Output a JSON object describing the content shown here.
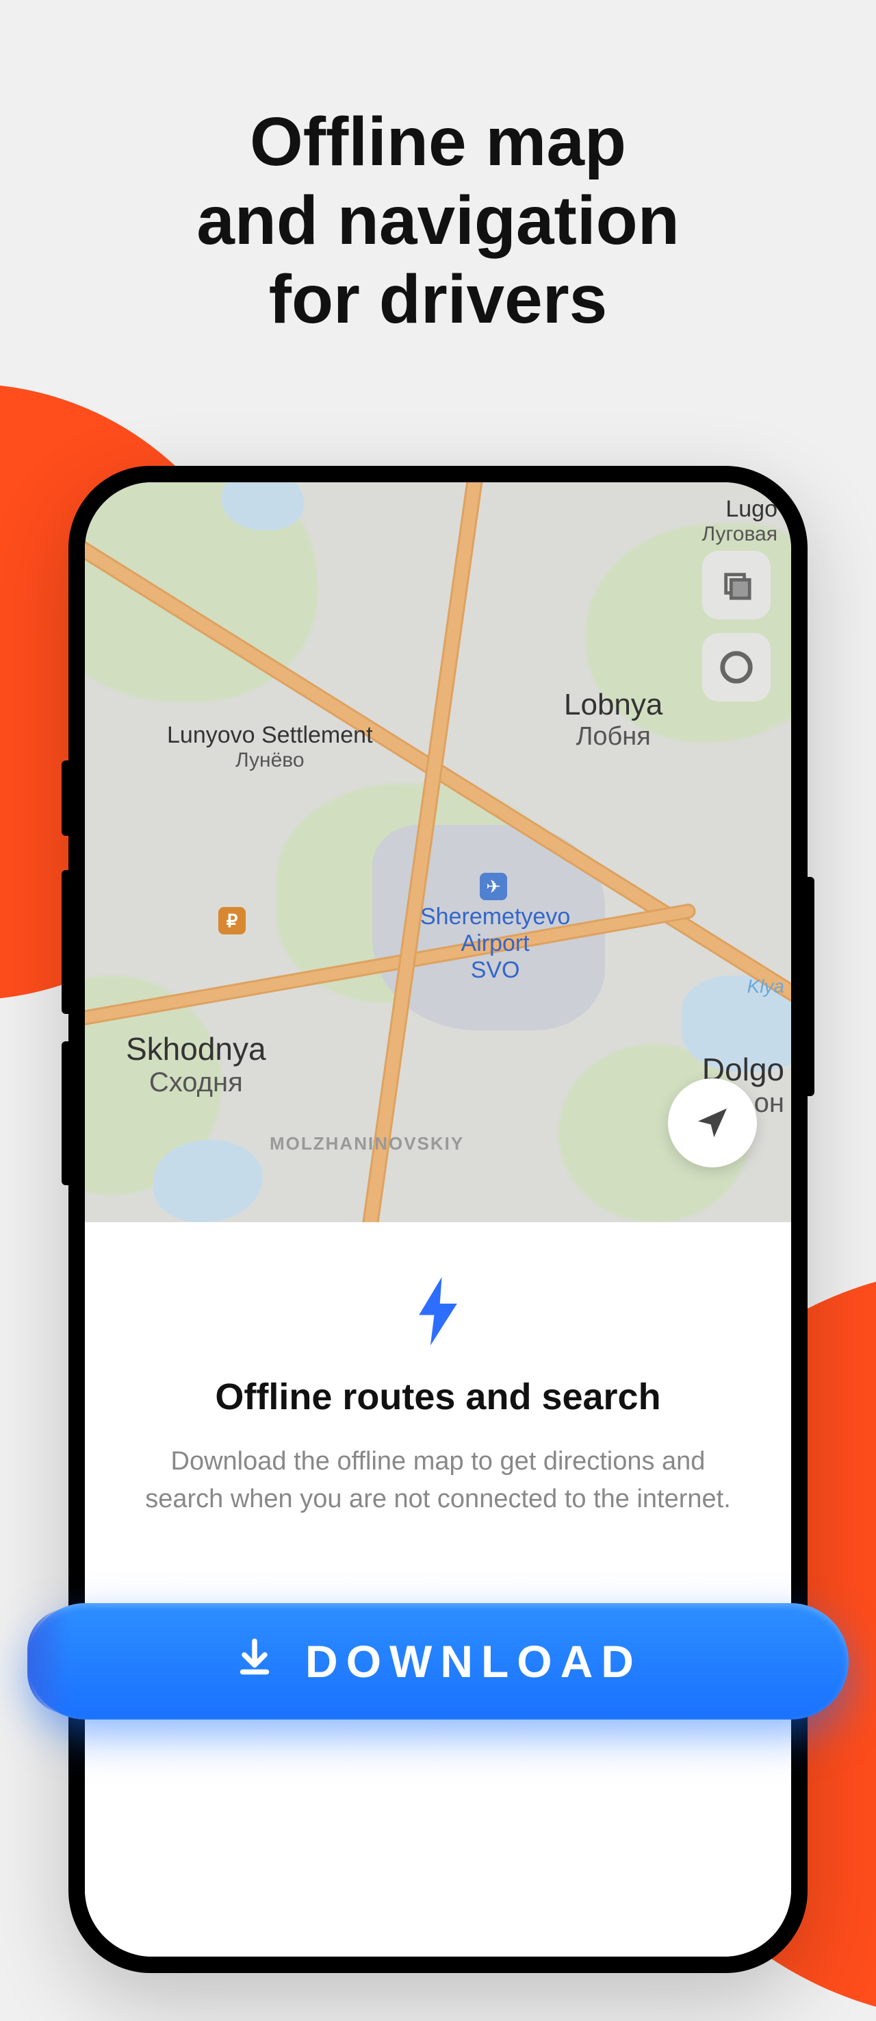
{
  "headline": {
    "line1": "Offline map",
    "line2": "and navigation",
    "line3": "for drivers"
  },
  "map": {
    "labels": {
      "lugovaya": {
        "en": "Lugo",
        "ru": "Луговая"
      },
      "lobnya": {
        "en": "Lobnya",
        "ru": "Лобня"
      },
      "lunyovo": {
        "en": "Lunyovo Settlement",
        "ru": "Лунёво"
      },
      "sheremetyevo": {
        "line1": "Sheremetyevo",
        "line2": "Airport",
        "line3": "SVO"
      },
      "skhodnya": {
        "en": "Skhodnya",
        "ru": "Сходня"
      },
      "dolgo": {
        "en": "Dolgo",
        "ru": "он"
      },
      "district": "MOLZHANINOVSKIY",
      "river": "Klya"
    },
    "poi": {
      "ruble": "₽",
      "plane": "✈"
    }
  },
  "card": {
    "title": "Offline routes and search",
    "body": "Download the offline map to get directions and search when you are not connected to the internet."
  },
  "download": {
    "label": "DOWNLOAD"
  }
}
